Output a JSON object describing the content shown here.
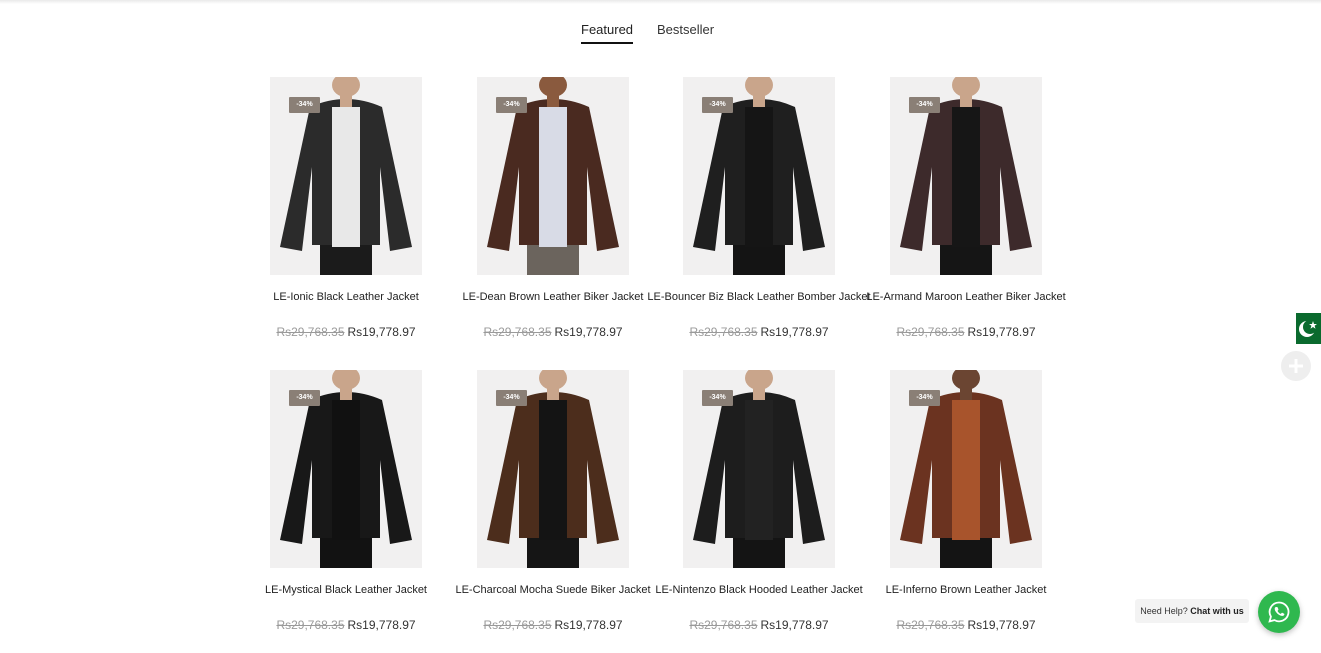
{
  "tabs": [
    {
      "label": "Featured",
      "active": true
    },
    {
      "label": "Bestseller",
      "active": false
    }
  ],
  "products": [
    {
      "badge": "-34%",
      "title": "LE-Ionic Black Leather Jacket",
      "old_price": "Rs29,768.35",
      "price": "Rs19,778.97",
      "jacket_color": "#2b2b2b",
      "inner_color": "#e8e8e8",
      "pants_color": "#1b1b1b"
    },
    {
      "badge": "-34%",
      "title": "LE-Dean Brown Leather Biker Jacket",
      "old_price": "Rs29,768.35",
      "price": "Rs19,778.97",
      "jacket_color": "#4a2a20",
      "inner_color": "#d8dbe6",
      "pants_color": "#6b645d"
    },
    {
      "badge": "-34%",
      "title": "LE-Bouncer Biz Black Leather Bomber Jacket",
      "old_price": "Rs29,768.35",
      "price": "Rs19,778.97",
      "jacket_color": "#1f1f1f",
      "inner_color": "#151515",
      "pants_color": "#141414"
    },
    {
      "badge": "-34%",
      "title": "LE-Armand Maroon Leather Biker Jacket",
      "old_price": "Rs29,768.35",
      "price": "Rs19,778.97",
      "jacket_color": "#3d2a2b",
      "inner_color": "#161616",
      "pants_color": "#151515"
    },
    {
      "badge": "-34%",
      "title": "LE-Mystical Black Leather Jacket",
      "old_price": "Rs29,768.35",
      "price": "Rs19,778.97",
      "jacket_color": "#181818",
      "inner_color": "#111111",
      "pants_color": "#121212"
    },
    {
      "badge": "-34%",
      "title": "LE-Charcoal Mocha Suede Biker Jacket",
      "old_price": "Rs29,768.35",
      "price": "Rs19,778.97",
      "jacket_color": "#4c2d1c",
      "inner_color": "#141414",
      "pants_color": "#151515"
    },
    {
      "badge": "-34%",
      "title": "LE-Nintenzo Black Hooded Leather Jacket",
      "old_price": "Rs29,768.35",
      "price": "Rs19,778.97",
      "jacket_color": "#1d1d1d",
      "inner_color": "#222222",
      "pants_color": "#141414"
    },
    {
      "badge": "-34%",
      "title": "LE-Inferno Brown Leather Jacket",
      "old_price": "Rs29,768.35",
      "price": "Rs19,778.97",
      "jacket_color": "#6b3320",
      "inner_color": "#a8542c",
      "pants_color": "#141414"
    }
  ],
  "widgets": {
    "flag": "pakistan-flag",
    "help_prefix": "Need Help?",
    "help_strong": "Chat with us",
    "whatsapp_icon": "whatsapp-icon",
    "accent_green": "#2fb84f"
  }
}
